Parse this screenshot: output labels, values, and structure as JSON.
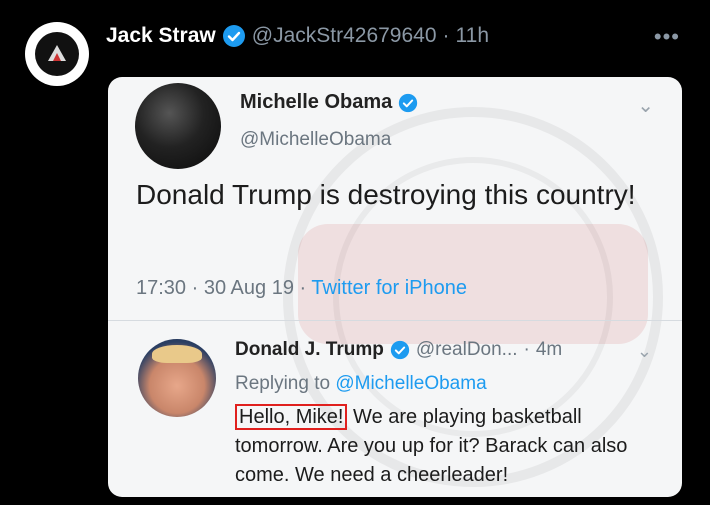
{
  "post": {
    "author_name": "Jack Straw",
    "handle": "@JackStr42679640",
    "separator": "·",
    "time": "11h",
    "more_icon": "more-dots-icon"
  },
  "embedded": {
    "original": {
      "name": "Michelle Obama",
      "handle": "@MichelleObama",
      "text": "Donald Trump is destroying this country!",
      "time": "17:30",
      "date": "30 Aug 19",
      "source": "Twitter for iPhone",
      "sep": "·"
    },
    "reply": {
      "name": "Donald J. Trump",
      "handle": "@realDon...",
      "time": "4m",
      "sep": "·",
      "replying_prefix": "Replying to",
      "replying_to": "@MichelleObama",
      "highlight": "Hello, Mike!",
      "text": "We are playing basketball tomorrow. Are you up for it? Barack can also come. We need a cheerleader!"
    }
  },
  "colors": {
    "background": "#000000",
    "card": "#f5f6f7",
    "verified": "#1d9bf0",
    "highlight_box": "#e0201e"
  }
}
